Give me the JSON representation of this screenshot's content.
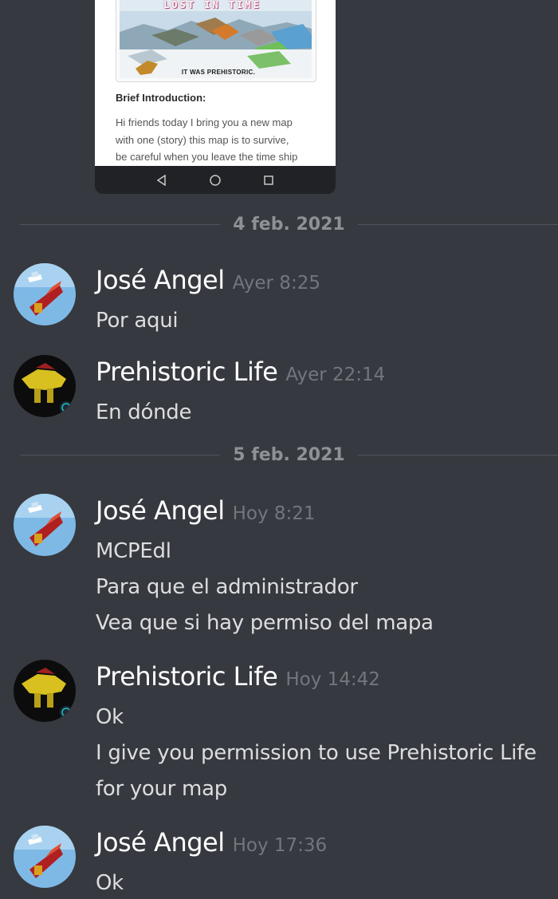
{
  "embed": {
    "map_title": "LOST IN TIME",
    "map_caption": "IT WAS PREHISTORIC.",
    "heading": "Brief Introduction:",
    "lines": [
      "Hi friends today I bring you a new map",
      "with one (story) this map is to survive,",
      "be careful when you leave the time ship"
    ]
  },
  "separators": [
    "4 feb. 2021",
    "5 feb. 2021"
  ],
  "messages": [
    {
      "author": "José Angel",
      "time": "Ayer 8:25",
      "lines": [
        "Por aqui"
      ]
    },
    {
      "author": "Prehistoric Life",
      "time": "Ayer 22:14",
      "lines": [
        "En dónde"
      ]
    },
    {
      "author": "José Angel",
      "time": "Hoy 8:21",
      "lines": [
        "MCPEdl",
        "Para que el administrador",
        "Vea que si hay permiso del mapa"
      ]
    },
    {
      "author": "Prehistoric Life",
      "time": "Hoy 14:42",
      "lines": [
        "Ok",
        "I give you permission to use Prehistoric Life",
        "for your map"
      ]
    },
    {
      "author": "José Angel",
      "time": "Hoy 17:36",
      "lines": [
        "Ok"
      ]
    }
  ],
  "colors": {
    "background": "#36393f",
    "author": "#ffffff",
    "timestamp": "#72767d",
    "message_text": "#dcddde",
    "separator_text": "#8e9297"
  }
}
